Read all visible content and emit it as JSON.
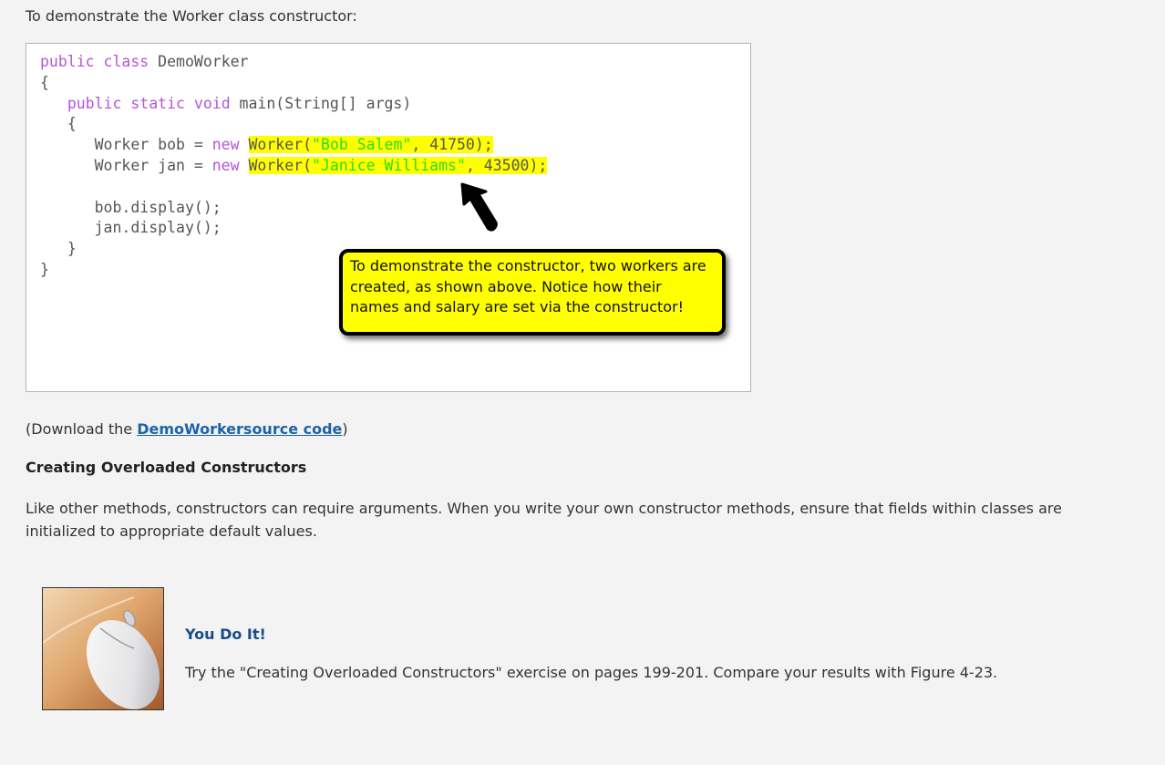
{
  "intro": "To demonstrate the Worker class constructor:",
  "code": {
    "line1_kw": "public class",
    "line1_rest": " DemoWorker",
    "line2": "{",
    "line3_kw": "public static void",
    "line3_rest": " main(String[] args)",
    "line4": "{",
    "line5_pre": "Worker bob = ",
    "line5_kw": "new",
    "line5_call_open": "Worker(",
    "line5_str": "\"Bob Salem\"",
    "line5_call_close": ", 41750);",
    "line6_pre": "Worker jan = ",
    "line6_kw": "new",
    "line6_call_open": "Worker(",
    "line6_str": "\"Janice Williams\"",
    "line6_call_close": ", 43500);",
    "line8": "bob.display();",
    "line9": "jan.display();",
    "line10": "}",
    "line11": "}"
  },
  "callout": "To demonstrate the constructor, two workers are created, as shown above.  Notice how their names and salary are set via the constructor!",
  "download": {
    "prefix": "(Download the ",
    "link": "DemoWorkersource code",
    "suffix": ")"
  },
  "section_heading": "Creating Overloaded Constructors",
  "paragraph": "Like other methods, constructors can require arguments. When you write your own constructor methods, ensure that fields within classes are initialized to appropriate default values.",
  "you_do_it": {
    "title": "You Do It!",
    "text": "Try the \"Creating Overloaded Constructors\" exercise on pages 199-201.  Compare your results with Figure 4-23."
  },
  "colors": {
    "background": "#f3f3f3",
    "keyword": "#b455d8",
    "string": "#2bdc16",
    "highlight": "#ffff00",
    "link": "#1c63a8",
    "ydi_title": "#1a4b8c"
  },
  "icons": {
    "thumbnail": "computer-mouse-photo",
    "pointer": "arrow-pointer-icon"
  }
}
